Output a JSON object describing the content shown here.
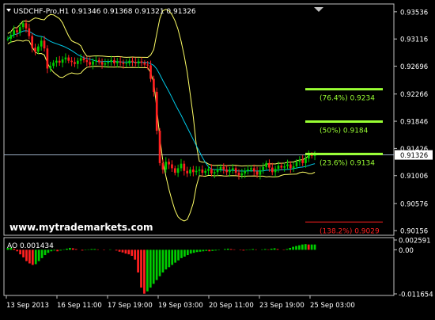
{
  "window": {
    "symbol_header": "USDCHF-Pro,H1  0.91346 0.91368 0.91321 0.91326",
    "watermark": "www.mytrademarkets.com"
  },
  "colors": {
    "background": "#000000",
    "frame": "#c0c0c0",
    "grid_dotted": "#5a5a5a",
    "candle_up": "#00cc00",
    "candle_down": "#ff2020",
    "bollinger": "#ffff66",
    "moving_average": "#00c8e6",
    "fib_green": "#99ff33",
    "fib_red": "#ff2020",
    "price_line": "#b0c4de",
    "ao_up": "#00cc00",
    "ao_down": "#ff2020",
    "text": "#ffffff"
  },
  "chart_data": [
    {
      "type": "candlestick",
      "title": "USDCHF-Pro,H1",
      "ohlc_header": {
        "open": 0.91346,
        "high": 0.91368,
        "low": 0.91321,
        "close": 0.91326
      },
      "ylim": [
        0.9011,
        0.9362
      ],
      "price_ticks": [
        "0.93536",
        "0.93116",
        "0.92696",
        "0.92266",
        "0.91846",
        "0.91426",
        "0.91326",
        "0.91006",
        "0.90576",
        "0.90156"
      ],
      "current_price": "0.91326",
      "x_ticks": [
        "13 Sep 2013",
        "16 Sep 11:00",
        "17 Sep 19:00",
        "19 Sep 03:00",
        "20 Sep 11:00",
        "23 Sep 19:00",
        "25 Sep 03:00"
      ],
      "close_series": [
        0.9312,
        0.9318,
        0.9325,
        0.9322,
        0.933,
        0.9336,
        0.9328,
        0.9316,
        0.9298,
        0.9292,
        0.93,
        0.9309,
        0.9297,
        0.9266,
        0.927,
        0.9275,
        0.9278,
        0.9275,
        0.928,
        0.9283,
        0.9278,
        0.9276,
        0.9273,
        0.9278,
        0.9282,
        0.9279,
        0.9276,
        0.9272,
        0.9277,
        0.9279,
        0.9276,
        0.9272,
        0.9274,
        0.9276,
        0.9279,
        0.9274,
        0.9277,
        0.9275,
        0.9273,
        0.9274,
        0.9278,
        0.9276,
        0.9274,
        0.9277,
        0.9275,
        0.9272,
        0.9271,
        0.925,
        0.923,
        0.917,
        0.912,
        0.911,
        0.9122,
        0.9118,
        0.9112,
        0.9105,
        0.9112,
        0.9119,
        0.9108,
        0.9104,
        0.911,
        0.9106,
        0.9108,
        0.911,
        0.9105,
        0.9108,
        0.9111,
        0.9104,
        0.9106,
        0.911,
        0.9114,
        0.911,
        0.9106,
        0.9109,
        0.9112,
        0.9105,
        0.9101,
        0.9104,
        0.9108,
        0.911,
        0.9112,
        0.9107,
        0.9102,
        0.9109,
        0.9114,
        0.912,
        0.9113,
        0.9106,
        0.9111,
        0.9116,
        0.9113,
        0.9115,
        0.9118,
        0.9112,
        0.9115,
        0.9122,
        0.9125,
        0.912,
        0.9127,
        0.9133,
        0.9131,
        0.9133
      ],
      "fibonacci_levels": [
        {
          "label": "(76.4%) 0.9234",
          "price": 0.9234,
          "color": "green"
        },
        {
          "label": "(50%) 0.9184",
          "price": 0.9184,
          "color": "green"
        },
        {
          "label": "(23.6%) 0.9134",
          "price": 0.9134,
          "color": "green"
        },
        {
          "label": "(138.2%) 0.9029",
          "price": 0.9029,
          "color": "red"
        }
      ],
      "indicators": [
        "Bollinger Bands",
        "Moving Average"
      ]
    },
    {
      "type": "bar",
      "title": "AO 0.001434",
      "indicator": "Awesome Oscillator",
      "ylim": [
        -0.011654,
        0.002591
      ],
      "ticks": [
        "0.002591",
        "0.00",
        "-0.011654"
      ],
      "values": [
        0.0005,
        0.0006,
        0.0003,
        -0.0004,
        -0.0012,
        -0.002,
        -0.003,
        -0.0036,
        -0.004,
        -0.0038,
        -0.003,
        -0.0022,
        -0.0014,
        -0.0008,
        -0.0004,
        -0.0002,
        -0.0004,
        -0.0002,
        0.0001,
        0.0003,
        0.0005,
        0.0004,
        0.0002,
        0.0,
        -0.0002,
        -0.0001,
        0.0001,
        0.0002,
        0.0002,
        0.0001,
        0.0,
        -0.0001,
        0.0,
        0.0001,
        0.0,
        -0.0002,
        -0.0005,
        -0.0007,
        -0.001,
        -0.0012,
        -0.0016,
        -0.0026,
        -0.006,
        -0.01,
        -0.0116,
        -0.011,
        -0.01,
        -0.009,
        -0.008,
        -0.007,
        -0.006,
        -0.0052,
        -0.0046,
        -0.004,
        -0.0034,
        -0.0028,
        -0.0022,
        -0.0018,
        -0.0014,
        -0.001,
        -0.0008,
        -0.0006,
        -0.0005,
        -0.0004,
        -0.0003,
        -0.0004,
        -0.0003,
        -0.0002,
        -0.0001,
        0.0,
        0.0002,
        0.0003,
        0.0002,
        0.0001,
        0.0,
        -0.0001,
        -0.0002,
        -0.0001,
        0.0001,
        0.0002,
        0.0001,
        0.0,
        0.0001,
        0.0002,
        0.0001,
        0.0003,
        0.0004,
        0.0002,
        0.0,
        -0.0001,
        0.0002,
        0.0005,
        0.0008,
        0.001,
        0.0012,
        0.0014,
        0.0015,
        0.0014,
        0.0014,
        0.0014
      ]
    }
  ]
}
